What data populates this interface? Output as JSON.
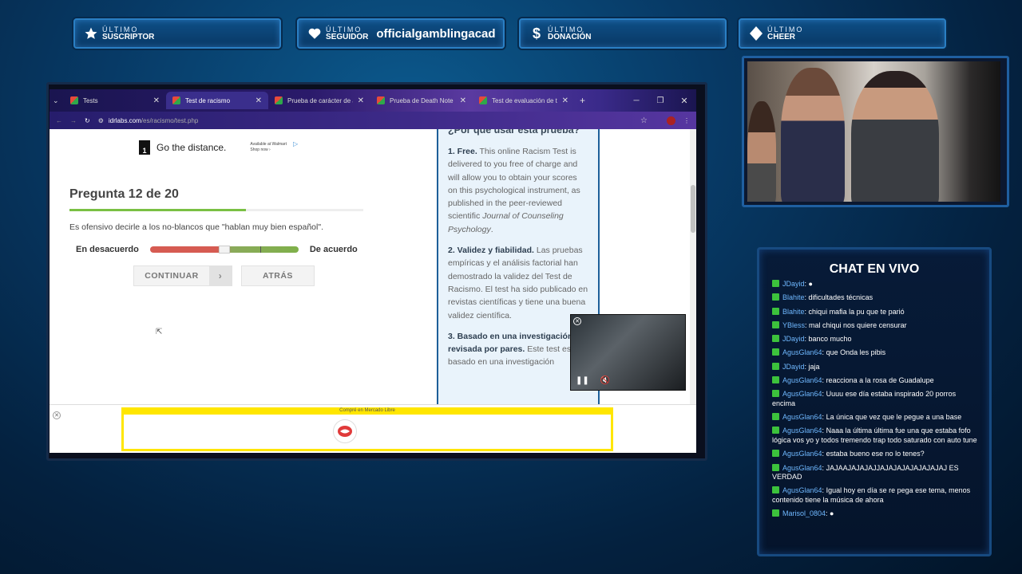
{
  "overlay": {
    "stats": [
      {
        "label1": "ÚLTIMO",
        "label2": "SUSCRIPTOR",
        "value": "",
        "icon": "star-icon"
      },
      {
        "label1": "ÚLTIMO",
        "label2": "SEGUIDOR",
        "value": "officialgamblingacad",
        "icon": "heart-icon"
      },
      {
        "label1": "ÚLTIMO",
        "label2": "DONACIÓN",
        "value": "",
        "icon": "dollar-icon"
      },
      {
        "label1": "ÚLTIMO",
        "label2": "CHEER",
        "value": "",
        "icon": "diamond-icon"
      }
    ]
  },
  "browser": {
    "tabs": [
      {
        "title": "Tests",
        "active": false
      },
      {
        "title": "Test de racismo",
        "active": true
      },
      {
        "title": "Prueba de carácter de Ju",
        "active": false
      },
      {
        "title": "Prueba de Death Note",
        "active": false
      },
      {
        "title": "Test de evaluación de tr",
        "active": false
      }
    ],
    "new_tab": "+",
    "url_domain": "idrlabs.com",
    "url_path": "/es/racismo/test.php"
  },
  "page": {
    "ad_top": {
      "brand": "1",
      "slogan": "Go the distance.",
      "side_line1": "Available at Walmart",
      "side_line2": "Shop now ›"
    },
    "question_title": "Pregunta 12 de 20",
    "progress_fraction": 0.6,
    "question_text": "Es ofensivo decirle a los no-blancos que \"hablan muy bien español\".",
    "scale_left": "En desacuerdo",
    "scale_right": "De acuerdo",
    "continue_label": "CONTINUAR",
    "back_label": "ATRÁS",
    "sidebar": {
      "heading": "¿Por qué usar esta prueba?",
      "p1_bold": "1. Free.",
      "p1_text": " This online Racism Test is delivered to you free of charge and will allow you to obtain your scores on this psychological instrument, as published in the peer-reviewed scientific ",
      "p1_italic": "Journal of Counseling Psychology",
      "p1_end": ".",
      "p2_bold": "2. Validez y fiabilidad.",
      "p2_text": " Las pruebas empíricas y el análisis factorial han demostrado la validez del Test de Racismo. El test ha sido publicado en revistas científicas y tiene una buena validez científica.",
      "p3_bold": "3. Basado en una investigación revisada por pares.",
      "p3_text": " Este test está basado en una investigación"
    },
    "bottom_ad_label": "Compré en Mercado Libre"
  },
  "chat": {
    "title": "CHAT EN VIVO",
    "messages": [
      {
        "user": "JDayid",
        "text": " ●"
      },
      {
        "user": "Blahite",
        "text": " dificultades técnicas"
      },
      {
        "user": "Blahite",
        "text": " chiqui mafia la pu que te parió"
      },
      {
        "user": "YBless",
        "text": " mal chiqui nos quiere censurar"
      },
      {
        "user": "JDayid",
        "text": " banco mucho"
      },
      {
        "user": "AgusGlan64",
        "text": " que Onda les pibis"
      },
      {
        "user": "JDayid",
        "text": " jaja"
      },
      {
        "user": "AgusGlan64",
        "text": " reacciona a la rosa de Guadalupe"
      },
      {
        "user": "AgusGlan64",
        "text": " Uuuu ese día estaba inspirado 20 porros encima"
      },
      {
        "user": "AgusGlan64",
        "text": " La única que vez que le pegue a una base"
      },
      {
        "user": "AgusGlan64",
        "text": " Naaa la última última fue una que estaba fofo lógica vos yo y todos tremendo trap todo saturado con auto tune"
      },
      {
        "user": "AgusGlan64",
        "text": " estaba bueno ese no lo tenes?"
      },
      {
        "user": "AgusGlan64",
        "text": " JAJAAJAJAJAJJAJAJAJAJAJAJAJAJ ES VERDAD"
      },
      {
        "user": "AgusGlan64",
        "text": " Igual hoy en día se re pega ese tema, menos contenido tiene la música de ahora"
      },
      {
        "user": "Marisol_0804",
        "text": " ●"
      }
    ]
  }
}
